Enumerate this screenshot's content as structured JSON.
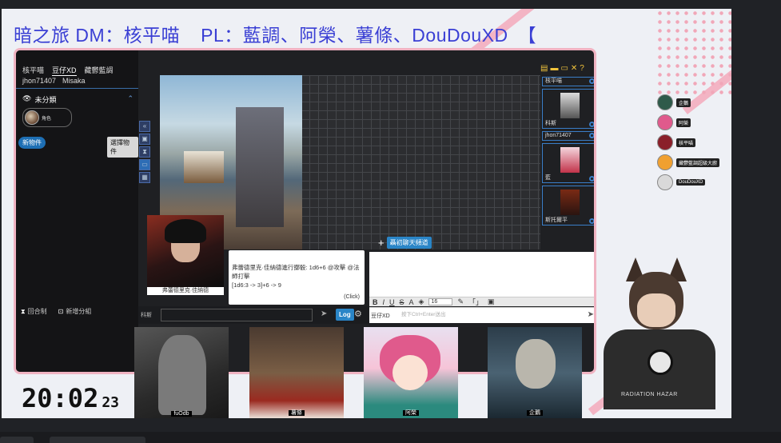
{
  "title": {
    "left": "暗之旅 DM：核平喵",
    "right": "PL：藍調、阿榮、薯條、DouDouXD　【"
  },
  "clock": {
    "time": "20:02",
    "seconds": "23"
  },
  "app": {
    "selector": [
      "核平喵",
      "豆仔XD",
      "藏鬱藍調"
    ],
    "user": [
      "jhon71407",
      "Misaka"
    ],
    "category": "未分類",
    "token_name": "角色",
    "new_token": "新物件",
    "select_token": "選擇物件",
    "round": "回合制",
    "new_group": "新增分組",
    "add_channel": "聶初聊天頻道",
    "roll_text": "弗蕾德里克·佳納德進行擲骰: 1d6+6 @攻擊 @法師打擊",
    "roll_result": "[1d6:3 -> 3]+6 -> 9",
    "roll_click": "(Click)",
    "portrait_caption": "弗蕾德里克·佳納德",
    "sel_name": "科斯",
    "log_label": "Log",
    "chat_user": "豆仔XD",
    "chat_hint": "按下Ctrl+Enter送出",
    "font_size": "16",
    "characters": [
      {
        "label": "核平喵",
        "name": "科斯"
      },
      {
        "label": "jhon71407",
        "name": "藍"
      },
      {
        "label": "",
        "name": "斯托爾平"
      }
    ]
  },
  "cams": [
    {
      "caption": "fuOdb"
    },
    {
      "caption": "薯條"
    },
    {
      "caption": "阿榮"
    },
    {
      "caption": "企鵝"
    }
  ],
  "participants": [
    {
      "name": "企鵝",
      "color": "#2f5a4a"
    },
    {
      "name": "阿榮",
      "color": "#e05a8c"
    },
    {
      "name": "核平喵",
      "color": "#8a1f2a"
    },
    {
      "name": "藏鬱藍調超級大廚",
      "color": "#f0a030"
    },
    {
      "name": "DouDouXD",
      "color": "#d9d9d9"
    }
  ],
  "vtuber_label": "RADIATION HAZAR"
}
